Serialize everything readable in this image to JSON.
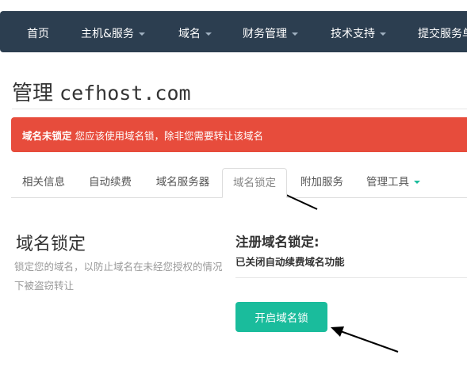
{
  "nav": {
    "items": [
      {
        "label": "首页",
        "dropdown": false
      },
      {
        "label": "主机&服务",
        "dropdown": true
      },
      {
        "label": "域名",
        "dropdown": true
      },
      {
        "label": "财务管理",
        "dropdown": true
      },
      {
        "label": "技术支持",
        "dropdown": true
      },
      {
        "label": "提交服务单",
        "dropdown": false
      }
    ]
  },
  "page": {
    "title_prefix": "管理",
    "title_domain": "cefhost.com"
  },
  "alert": {
    "strong": "域名未锁定",
    "text": "您应该使用域名锁，除非您需要转让该域名",
    "color": "#e74c3c"
  },
  "tabs": [
    {
      "label": "相关信息",
      "active": false
    },
    {
      "label": "自动续费",
      "active": false
    },
    {
      "label": "域名服务器",
      "active": false
    },
    {
      "label": "域名锁定",
      "active": true
    },
    {
      "label": "附加服务",
      "active": false
    },
    {
      "label": "管理工具",
      "active": false,
      "dropdown": true
    }
  ],
  "section": {
    "title": "域名锁定",
    "description": "锁定您的域名，以防止域名在未经您授权的情况下被盗窃转让"
  },
  "registrar_lock": {
    "title": "注册域名锁定:",
    "status": "已关闭自动续费域名功能",
    "button_label": "开启域名锁",
    "button_color": "#1abc9c"
  },
  "colors": {
    "navbar": "#2c3e50",
    "accent": "#1abc9c"
  }
}
